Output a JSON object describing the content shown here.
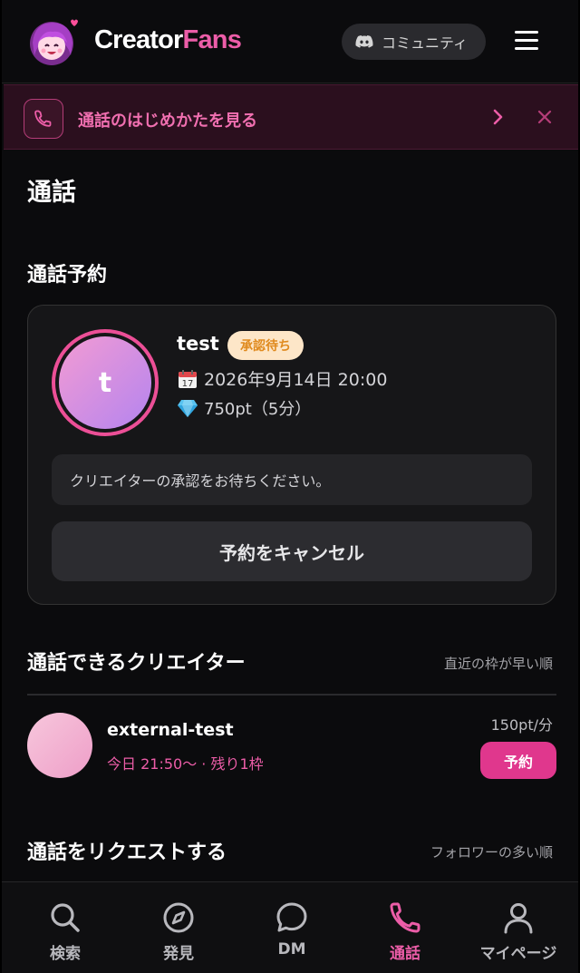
{
  "header": {
    "logo_part1": "Creator",
    "logo_part2": "Fans",
    "community_label": "コミュニティ"
  },
  "banner": {
    "text": "通話のはじめかたを見る"
  },
  "page": {
    "title": "通話"
  },
  "reservation": {
    "section_title": "通話予約",
    "name": "test",
    "avatar_initial": "t",
    "status_badge": "承認待ち",
    "datetime": "2026年9月14日 20:00",
    "price": "750pt（5分）",
    "note": "クリエイターの承認をお待ちください。",
    "cancel_label": "予約をキャンセル"
  },
  "available": {
    "section_title": "通話できるクリエイター",
    "sort_label": "直近の枠が早い順",
    "creators": [
      {
        "name": "external-test",
        "slot": "今日 21:50〜 · 残り1枠",
        "price": "150pt/分",
        "book_label": "予約"
      }
    ]
  },
  "request": {
    "section_title": "通話をリクエストする",
    "sort_label": "フォロワーの多い順"
  },
  "nav": {
    "items": [
      {
        "label": "検索",
        "icon": "search-icon"
      },
      {
        "label": "発見",
        "icon": "compass-icon"
      },
      {
        "label": "DM",
        "icon": "chat-bubble-icon"
      },
      {
        "label": "通話",
        "icon": "phone-icon",
        "active": true
      },
      {
        "label": "マイページ",
        "icon": "user-icon"
      }
    ]
  },
  "colors": {
    "brand_pink": "#ec5da8",
    "book_button": "#e0378d",
    "badge_bg": "#fde6c8",
    "badge_text": "#e08a1e",
    "background": "#0b0b0d"
  }
}
